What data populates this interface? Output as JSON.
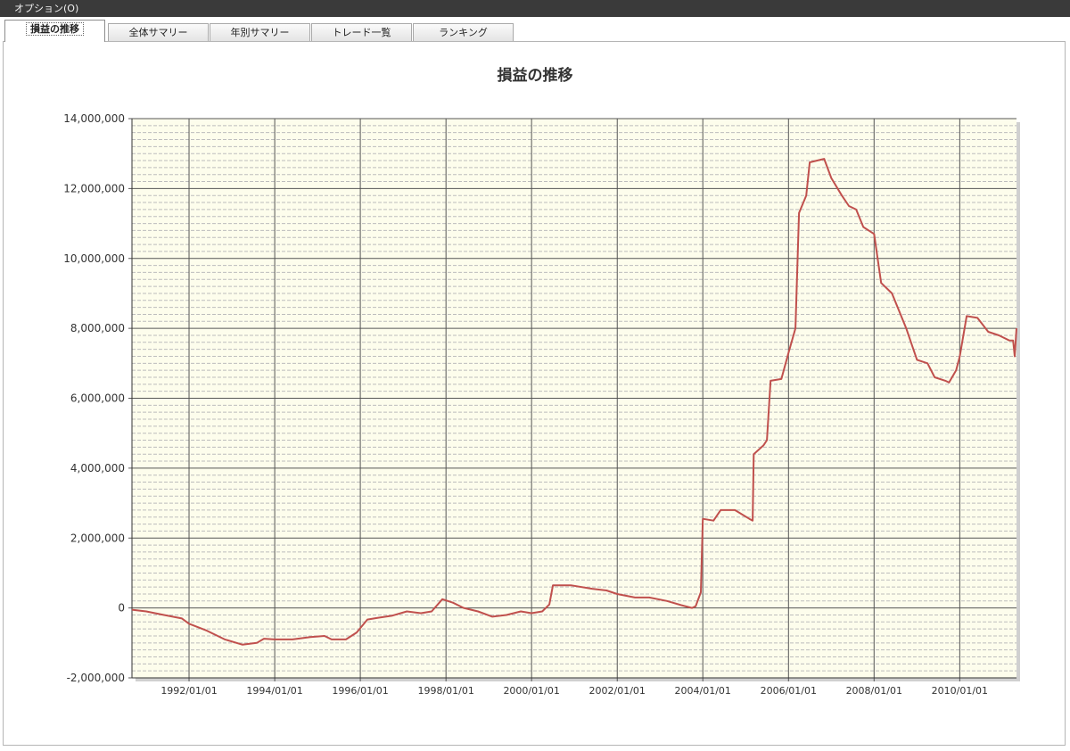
{
  "menu": {
    "options_label": "オプション(O)"
  },
  "tabs": [
    {
      "label": "損益の推移",
      "active": true
    },
    {
      "label": "全体サマリー",
      "active": false
    },
    {
      "label": "年別サマリー",
      "active": false
    },
    {
      "label": "トレード一覧",
      "active": false
    },
    {
      "label": "ランキング",
      "active": false
    }
  ],
  "colors": {
    "line": "#c0504d",
    "plot_bg": "#fdfdec",
    "grid_major": "#555555",
    "grid_minor": "#bdbdbd"
  },
  "chart_data": {
    "type": "line",
    "title": "損益の推移",
    "xlabel": "",
    "ylabel": "",
    "ylim": [
      -2000000,
      14000000
    ],
    "yticks": [
      -2000000,
      0,
      2000000,
      4000000,
      6000000,
      8000000,
      10000000,
      12000000,
      14000000
    ],
    "ytick_labels": [
      "-2,000,000",
      "0",
      "2,000,000",
      "4,000,000",
      "6,000,000",
      "8,000,000",
      "10,000,000",
      "12,000,000",
      "14,000,000"
    ],
    "xlim": [
      "1990-09-01",
      "2011-04-30"
    ],
    "xticks": [
      "1992-01-01",
      "1994-01-01",
      "1996-01-01",
      "1998-01-01",
      "2000-01-01",
      "2002-01-01",
      "2004-01-01",
      "2006-01-01",
      "2008-01-01",
      "2010-01-01"
    ],
    "xtick_labels": [
      "1992/01/01",
      "1994/01/01",
      "1996/01/01",
      "1998/01/01",
      "2000/01/01",
      "2002/01/01",
      "2004/01/01",
      "2006/01/01",
      "2008/01/01",
      "2010/01/01"
    ],
    "grid": true,
    "series": [
      {
        "points": [
          [
            "1990-09-01",
            -50000
          ],
          [
            "1991-01-01",
            -100000
          ],
          [
            "1991-06-01",
            -200000
          ],
          [
            "1991-11-01",
            -300000
          ],
          [
            "1992-01-01",
            -450000
          ],
          [
            "1992-06-01",
            -650000
          ],
          [
            "1992-11-01",
            -900000
          ],
          [
            "1993-04-01",
            -1050000
          ],
          [
            "1993-08-01",
            -1000000
          ],
          [
            "1993-10-01",
            -880000
          ],
          [
            "1994-01-01",
            -900000
          ],
          [
            "1994-06-01",
            -900000
          ],
          [
            "1994-11-01",
            -830000
          ],
          [
            "1995-03-01",
            -800000
          ],
          [
            "1995-05-01",
            -900000
          ],
          [
            "1995-09-01",
            -900000
          ],
          [
            "1995-12-01",
            -700000
          ],
          [
            "1996-03-01",
            -330000
          ],
          [
            "1996-06-01",
            -280000
          ],
          [
            "1996-10-01",
            -220000
          ],
          [
            "1997-02-01",
            -100000
          ],
          [
            "1997-06-01",
            -150000
          ],
          [
            "1997-09-01",
            -100000
          ],
          [
            "1997-12-01",
            250000
          ],
          [
            "1998-03-01",
            150000
          ],
          [
            "1998-06-01",
            0
          ],
          [
            "1998-10-01",
            -100000
          ],
          [
            "1999-02-01",
            -250000
          ],
          [
            "1999-06-01",
            -200000
          ],
          [
            "1999-10-01",
            -100000
          ],
          [
            "2000-01-01",
            -150000
          ],
          [
            "2000-04-01",
            -100000
          ],
          [
            "2000-06-01",
            100000
          ],
          [
            "2000-07-01",
            650000
          ],
          [
            "2000-12-01",
            650000
          ],
          [
            "2001-06-01",
            550000
          ],
          [
            "2001-10-01",
            500000
          ],
          [
            "2002-01-01",
            400000
          ],
          [
            "2002-06-01",
            300000
          ],
          [
            "2002-10-01",
            300000
          ],
          [
            "2003-03-01",
            200000
          ],
          [
            "2003-07-01",
            80000
          ],
          [
            "2003-10-01",
            0
          ],
          [
            "2003-11-01",
            50000
          ],
          [
            "2003-12-15",
            450000
          ],
          [
            "2004-01-01",
            2550000
          ],
          [
            "2004-04-01",
            2500000
          ],
          [
            "2004-06-01",
            2800000
          ],
          [
            "2004-10-01",
            2800000
          ],
          [
            "2005-02-01",
            2550000
          ],
          [
            "2005-03-01",
            2500000
          ],
          [
            "2005-03-10",
            4400000
          ],
          [
            "2005-06-01",
            4650000
          ],
          [
            "2005-07-01",
            4800000
          ],
          [
            "2005-08-01",
            6500000
          ],
          [
            "2005-11-01",
            6550000
          ],
          [
            "2006-01-01",
            7300000
          ],
          [
            "2006-03-01",
            8000000
          ],
          [
            "2006-04-01",
            11300000
          ],
          [
            "2006-06-01",
            11800000
          ],
          [
            "2006-07-01",
            12750000
          ],
          [
            "2006-11-01",
            12850000
          ],
          [
            "2007-01-01",
            12300000
          ],
          [
            "2007-04-01",
            11800000
          ],
          [
            "2007-06-01",
            11500000
          ],
          [
            "2007-08-01",
            11400000
          ],
          [
            "2007-10-01",
            10900000
          ],
          [
            "2008-01-01",
            10700000
          ],
          [
            "2008-03-01",
            9300000
          ],
          [
            "2008-06-01",
            9000000
          ],
          [
            "2008-10-01",
            8000000
          ],
          [
            "2009-01-01",
            7100000
          ],
          [
            "2009-04-01",
            7000000
          ],
          [
            "2009-06-01",
            6600000
          ],
          [
            "2009-09-01",
            6500000
          ],
          [
            "2009-10-01",
            6450000
          ],
          [
            "2009-12-01",
            6800000
          ],
          [
            "2010-01-01",
            7200000
          ],
          [
            "2010-03-01",
            8350000
          ],
          [
            "2010-06-01",
            8300000
          ],
          [
            "2010-09-01",
            7900000
          ],
          [
            "2010-12-01",
            7800000
          ],
          [
            "2011-03-01",
            7650000
          ],
          [
            "2011-04-01",
            7650000
          ],
          [
            "2011-04-15",
            7200000
          ],
          [
            "2011-04-30",
            8000000
          ]
        ]
      }
    ]
  }
}
